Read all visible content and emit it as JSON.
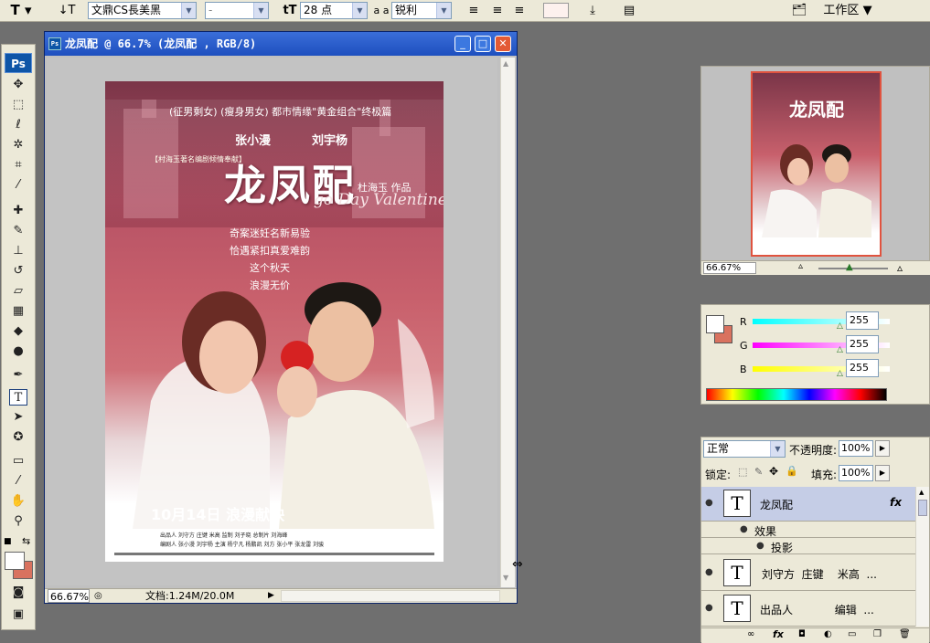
{
  "options_bar": {
    "tool_icon": "type-tool-icon",
    "orient_icon": "text-orientation-icon",
    "font_family": "文鼎CS長美黑",
    "font_style": "-",
    "size_icon": "font-size-icon",
    "font_size": "28 点",
    "aa_label": "a a",
    "antialias": "锐利",
    "color_swatch": "#fdf1ee",
    "workspace_label": "工作区"
  },
  "toolbox": {
    "logo": "Ps"
  },
  "document": {
    "title": "龙凤配 @ 66.7% (龙凤配 , RGB/8)",
    "zoom": "66.67%",
    "doc_info": "文档:1.24M/20.0M",
    "buttons": {
      "minimize": "_",
      "maximize": "□",
      "close": "✕"
    }
  },
  "poster": {
    "tagline": "(征男剩女) (瘦身男女) 都市情缘\"黄金组合\"终极篇",
    "star_left": "张小漫",
    "star_right": "刘宇杨",
    "badge": "【村海玉著名编剧倾情奉献】",
    "title": "龙凤配",
    "author": "杜海玉 作品",
    "script_text": "go Day Valentine",
    "lines": [
      "奇案迷妊名新易验",
      "恰遇紧扣真爱难韵",
      "这个秋天",
      "浪漫无价"
    ],
    "release": "10月14日  浪漫献映",
    "credits_1": "出品人 刘守方  庄键  米高  监制 刘子晓  总制片 刘海峰",
    "credits_2": "编剧人 张小漫  刘宇杨  主演 杨宁凡  杨鹏凯  刘方  张小平  张龙雷  刘骏"
  },
  "navigator": {
    "zoom": "66.67%"
  },
  "color": {
    "r_label": "R",
    "g_label": "G",
    "b_label": "B",
    "r_value": "255",
    "g_value": "255",
    "b_value": "255",
    "fg": "#ffffff",
    "bg": "#d9725f"
  },
  "layers": {
    "blend_mode": "正常",
    "opacity_label": "不透明度:",
    "opacity": "100%",
    "lock_label": "锁定:",
    "fill_label": "填充:",
    "fill": "100%",
    "items": [
      {
        "name": "龙凤配",
        "thumb": "T",
        "fx": "fx"
      },
      {
        "name": "效果"
      },
      {
        "name": "投影"
      },
      {
        "name": "刘守方  庄键    米高  ...",
        "thumb": "T"
      },
      {
        "name": "出品人            编辑  ...",
        "thumb": "T"
      }
    ]
  }
}
